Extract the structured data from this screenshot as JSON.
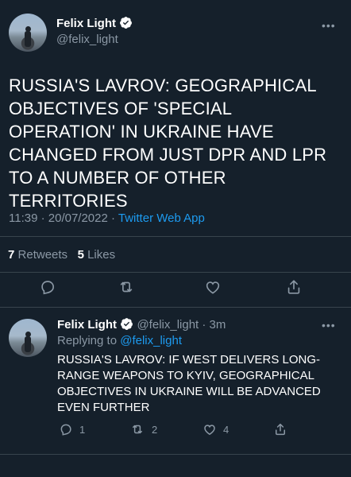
{
  "tweet": {
    "author": {
      "name": "Felix Light",
      "handle": "@felix_light"
    },
    "text": "RUSSIA'S LAVROV: GEOGRAPHICAL OBJECTIVES OF 'SPECIAL OPERATION' IN UKRAINE HAVE CHANGED FROM JUST DPR AND LPR TO A NUMBER OF OTHER TERRITORIES",
    "time": "11:39 · 20/07/2022 · ",
    "source": "Twitter Web App",
    "retweets": {
      "count": "7",
      "label": "Retweets"
    },
    "likes": {
      "count": "5",
      "label": "Likes"
    }
  },
  "reply": {
    "author": {
      "name": "Felix Light",
      "handle_time": "@felix_light · 3m"
    },
    "replying_to_label": "Replying to ",
    "replying_to_handle": "@felix_light",
    "text": "RUSSIA'S LAVROV: IF WEST DELIVERS LONG-RANGE WEAPONS TO KYIV, GEOGRAPHICAL OBJECTIVES IN UKRAINE WILL BE ADVANCED EVEN FURTHER",
    "reply_count": "1",
    "retweet_count": "2",
    "like_count": "4"
  },
  "colors": {
    "background": "#15202b",
    "accent": "#1d9bf0",
    "secondary": "#8b98a5",
    "divider": "#38444d"
  },
  "icons": [
    "verified-badge-icon",
    "more-icon",
    "reply-icon",
    "retweet-icon",
    "like-icon",
    "share-icon"
  ]
}
